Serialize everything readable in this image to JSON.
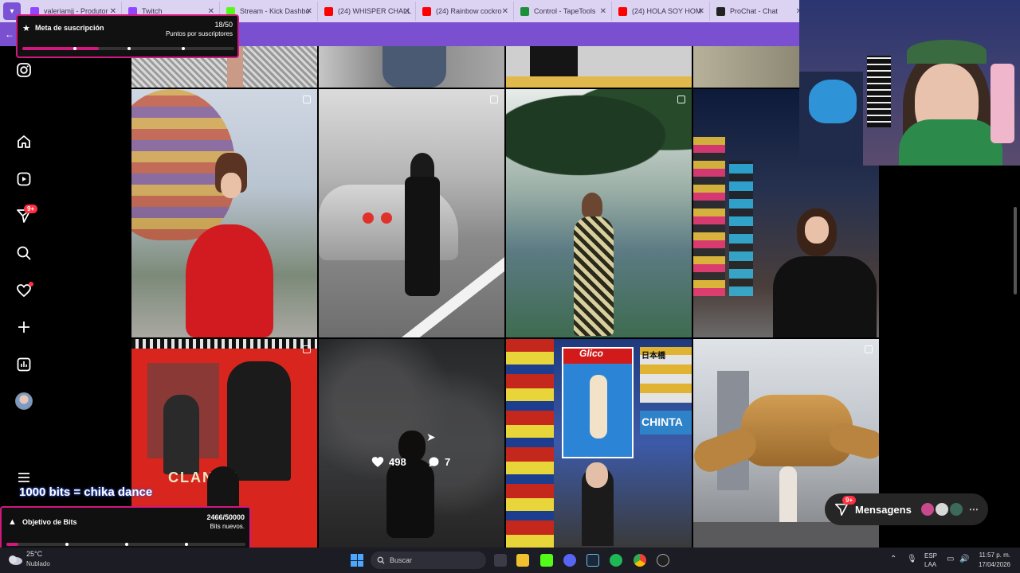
{
  "tabs": [
    {
      "label": "valeriamjj - Produtor",
      "color": "#9146ff"
    },
    {
      "label": "Twitch",
      "color": "#9146ff"
    },
    {
      "label": "Stream - Kick Dashbo",
      "color": "#53fc18"
    },
    {
      "label": "(24) WHISPER CHALL",
      "color": "#ff0000"
    },
    {
      "label": "(24) Rainbow cockro",
      "color": "#ff0000"
    },
    {
      "label": "Control - TapeTools",
      "color": "#1b8f3a"
    },
    {
      "label": "(24) HOLA SOY HOM",
      "color": "#ff0000"
    },
    {
      "label": "ProChat - Chat",
      "color": "#222222"
    }
  ],
  "sub_goal": {
    "title": "Meta de suscripción",
    "count": "18/50",
    "subtitle": "Puntos por suscriptores",
    "progress": 0.36
  },
  "bits_overlay": {
    "banner": "1000 bits = chika dance",
    "title": "Objetivo de Bits",
    "count": "2466/50000",
    "subtitle": "Bits nuevos.",
    "progress": 0.05
  },
  "nav": {
    "badge": "9+",
    "icons": [
      "instagram-icon",
      "home-icon",
      "reels-icon",
      "direct-icon",
      "search-icon",
      "notifications-icon",
      "create-icon",
      "dashboard-icon",
      "profile-avatar",
      "menu-icon"
    ]
  },
  "post_hover": {
    "likes": "498",
    "comments": "7"
  },
  "posters": {
    "clancy": "CLANCY",
    "glico": "Glico",
    "chinta": "CHINTA",
    "japan": "日本橋"
  },
  "messages": {
    "label": "Mensagens",
    "badge": "9+"
  },
  "taskbar": {
    "weather_temp": "25°C",
    "weather_desc": "Nublado",
    "search_placeholder": "Buscar",
    "lang1": "ESP",
    "lang2": "LAA",
    "time": "11:57 p. m.",
    "date": "17/04/2026"
  },
  "colors": {
    "accent": "#d0187e",
    "twitch": "#7a4fd0",
    "badge": "#ff3040"
  }
}
